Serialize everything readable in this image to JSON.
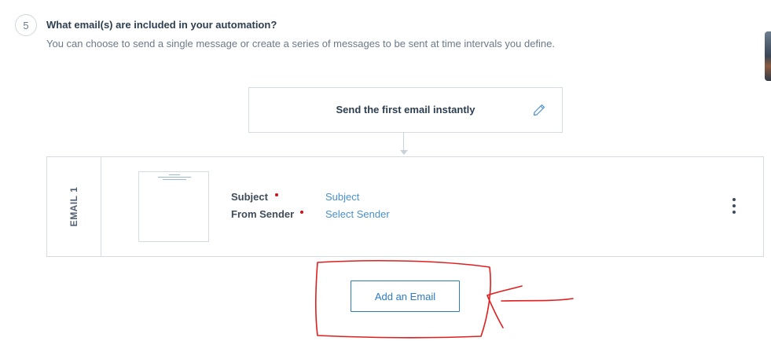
{
  "step": {
    "number": "5",
    "title": "What email(s) are included in your automation?",
    "description": "You can choose to send a single message or create a series of messages to be sent at time intervals you define."
  },
  "trigger": {
    "label": "Send the first email instantly",
    "edit_icon": "pencil-icon"
  },
  "email_card": {
    "tab_label": "EMAIL 1",
    "subject_label": "Subject",
    "subject_value": "Subject",
    "sender_label": "From Sender",
    "sender_value": "Select Sender",
    "menu_icon": "vertical-ellipsis-icon"
  },
  "add_email_button": "Add an Email",
  "colors": {
    "accent": "#2c7bc4",
    "link": "#4a90cc",
    "required": "#c4151c",
    "annotation": "#e01e1e"
  }
}
